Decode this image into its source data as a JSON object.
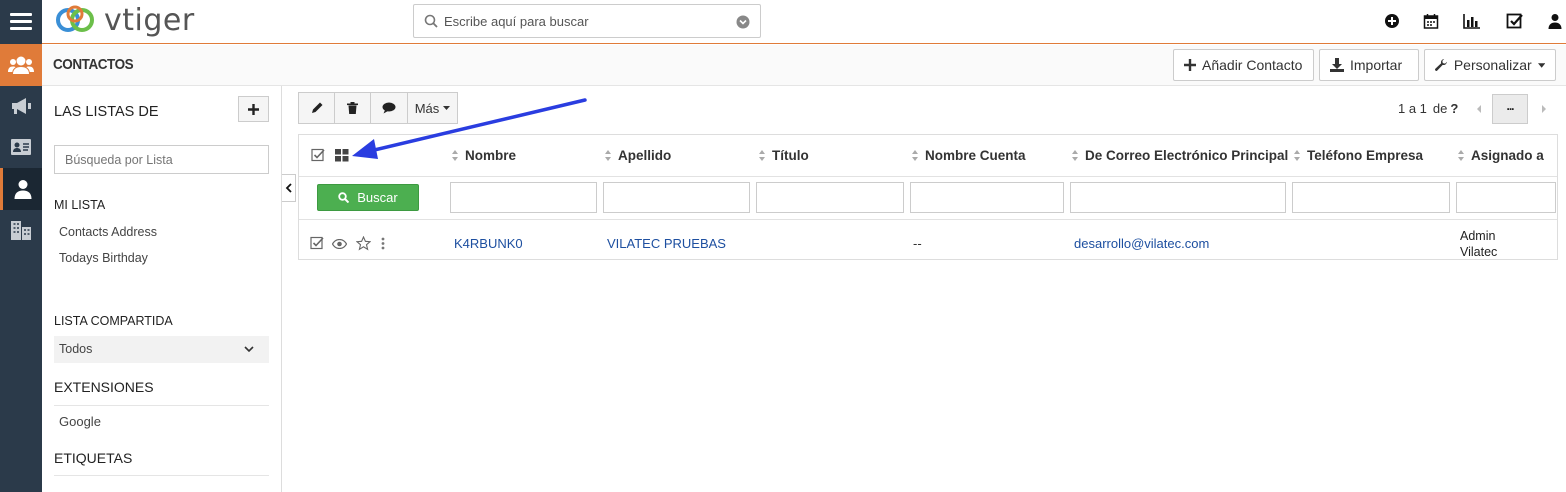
{
  "app": {
    "logo_text": "vtiger"
  },
  "search": {
    "placeholder": "Escribe aquí para buscar"
  },
  "module": {
    "title": "CONTACTOS",
    "buttons": {
      "add": "Añadir Contacto",
      "import": "Importar",
      "customize": "Personalizar"
    }
  },
  "sidebar": {
    "lists_heading": "LAS LISTAS DE",
    "list_search_placeholder": "Búsqueda por Lista",
    "my_list_heading": "MI LISTA",
    "my_lists": [
      "Contacts Address",
      "Todays Birthday"
    ],
    "shared_heading": "LISTA COMPARTIDA",
    "shared_selected": "Todos",
    "extensions_heading": "EXTENSIONES",
    "extensions": [
      "Google"
    ],
    "tags_heading": "ETIQUETAS"
  },
  "toolbar": {
    "more_label": "Más"
  },
  "pagination": {
    "range": "1 a 1",
    "of": "de",
    "total": "?"
  },
  "table": {
    "columns": [
      "Nombre",
      "Apellido",
      "Título",
      "Nombre Cuenta",
      "De Correo Electrónico Principal",
      "Teléfono Empresa",
      "Asignado a"
    ],
    "search_button": "Buscar",
    "rows": [
      {
        "nombre": "K4RBUNK0",
        "apellido": "VILATEC PRUEBAS",
        "titulo": "",
        "cuenta": "--",
        "correo": "desarrollo@vilatec.com",
        "telefono": "",
        "asignado_1": "Admin",
        "asignado_2": "Vilatec"
      }
    ]
  },
  "colors": {
    "accent": "#e07b39",
    "rail": "#2b3a4a",
    "search_btn": "#4caf50",
    "link": "#1d4fa0",
    "annotation_arrow": "#2a3de0"
  }
}
